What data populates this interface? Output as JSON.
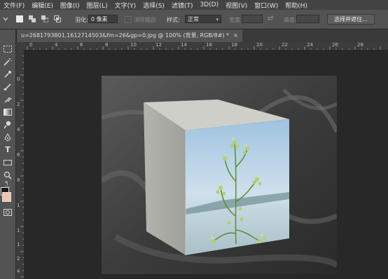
{
  "menu": [
    "文件(F)",
    "编辑(E)",
    "图像(I)",
    "图层(L)",
    "文字(Y)",
    "选择(S)",
    "滤镜(T)",
    "3D(D)",
    "视图(V)",
    "窗口(W)",
    "帮助(H)"
  ],
  "options": {
    "feather_label": "羽化:",
    "feather_value": "0 像素",
    "antialias_label": "消除锯齿",
    "style_label": "样式:",
    "style_value": "正常",
    "width_label": "宽度:",
    "height_label": "高度:",
    "select_mask_button": "选择并遮住..."
  },
  "document": {
    "tab_title": "u=2681793801,1612714503&fm=26&gp=0.jpg @ 100% (背景, RGB/8#) *",
    "close_glyph": "×"
  },
  "ruler_top_ticks": [
    "0",
    "4",
    "6",
    "8",
    "10",
    "12",
    "14",
    "16",
    "18",
    "20",
    "22",
    "24",
    "26",
    "28"
  ],
  "ruler_left_ticks": [
    "0",
    "2",
    "4",
    "6",
    "8",
    "1",
    "1",
    "1",
    "2",
    "4"
  ],
  "colors": {
    "foreground": "#1a1a1a",
    "background": "#f0c3b0",
    "workspace": "#282828",
    "panel": "#535353"
  },
  "tools": [
    "marquee-icon",
    "magic-wand-icon",
    "eyedropper-icon",
    "brush-icon",
    "clone-stamp-icon",
    "gradient-icon",
    "dodge-icon",
    "pen-icon",
    "type-icon",
    "rectangle-icon",
    "zoom-icon"
  ]
}
